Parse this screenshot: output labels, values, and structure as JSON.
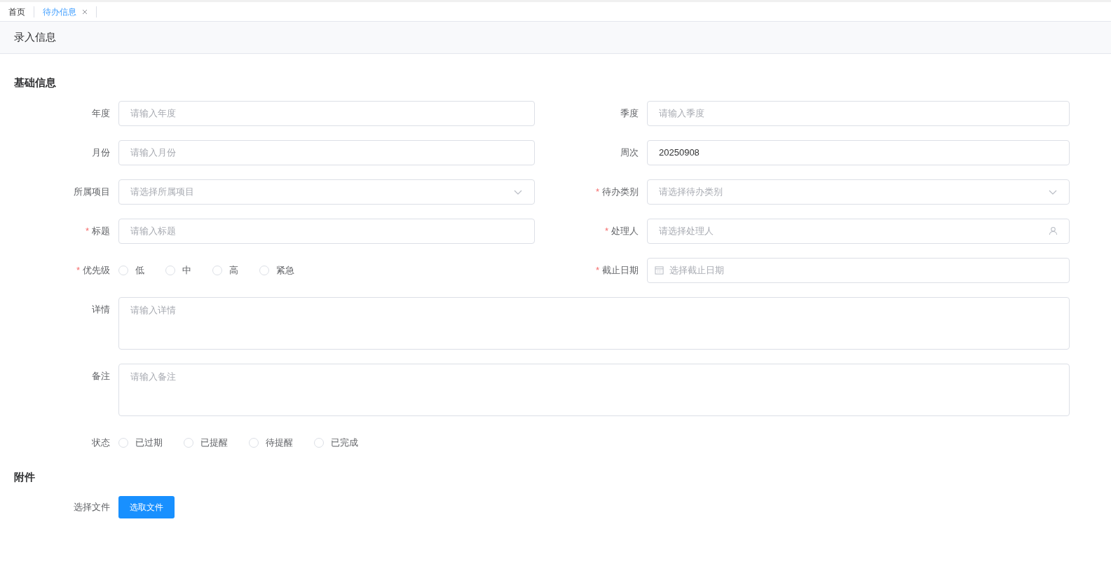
{
  "tabs": [
    {
      "label": "首页",
      "selected": false,
      "closable": false
    },
    {
      "label": "待办信息",
      "selected": true,
      "closable": true
    }
  ],
  "page_title": "录入信息",
  "sections": [
    {
      "title": "基础信息",
      "rows": [
        [
          {
            "kind": "input",
            "label": "年度",
            "placeholder": "请输入年度"
          },
          {
            "kind": "input",
            "label": "季度",
            "placeholder": "请输入季度"
          }
        ],
        [
          {
            "kind": "input",
            "label": "月份",
            "placeholder": "请输入月份"
          },
          {
            "kind": "input",
            "label": "周次",
            "value": "20250908"
          }
        ],
        [
          {
            "kind": "select",
            "label": "所属项目",
            "placeholder": "请选择所属项目"
          },
          {
            "kind": "select",
            "label": "待办类别",
            "required_mark": "*",
            "placeholder": "请选择待办类别"
          }
        ],
        [
          {
            "kind": "input",
            "label": "标题",
            "required_mark": "*",
            "placeholder": "请输入标题"
          },
          {
            "kind": "user",
            "label": "处理人",
            "required_mark": "*",
            "placeholder": "请选择处理人"
          }
        ],
        [
          {
            "kind": "radio",
            "label": "优先级",
            "required_mark": "*",
            "options": [
              {
                "label": "低",
                "selected": false
              },
              {
                "label": "中",
                "selected": false
              },
              {
                "label": "高",
                "selected": false
              },
              {
                "label": "紧急",
                "selected": false
              }
            ]
          },
          {
            "kind": "date",
            "label": "截止日期",
            "required_mark": "*",
            "placeholder": "选择截止日期"
          }
        ],
        [
          {
            "kind": "textarea",
            "label": "详情",
            "placeholder": "请输入详情"
          }
        ],
        [
          {
            "kind": "textarea",
            "label": "备注",
            "placeholder": "请输入备注"
          }
        ],
        [
          {
            "kind": "radio",
            "label": "状态",
            "options": [
              {
                "label": "已过期",
                "selected": false
              },
              {
                "label": "已提醒",
                "selected": false
              },
              {
                "label": "待提醒",
                "selected": false
              },
              {
                "label": "已完成",
                "selected": false
              }
            ]
          }
        ]
      ]
    },
    {
      "title": "附件",
      "rows": [
        [
          {
            "kind": "file",
            "label": "选择文件",
            "button": "选取文件"
          }
        ]
      ]
    }
  ]
}
